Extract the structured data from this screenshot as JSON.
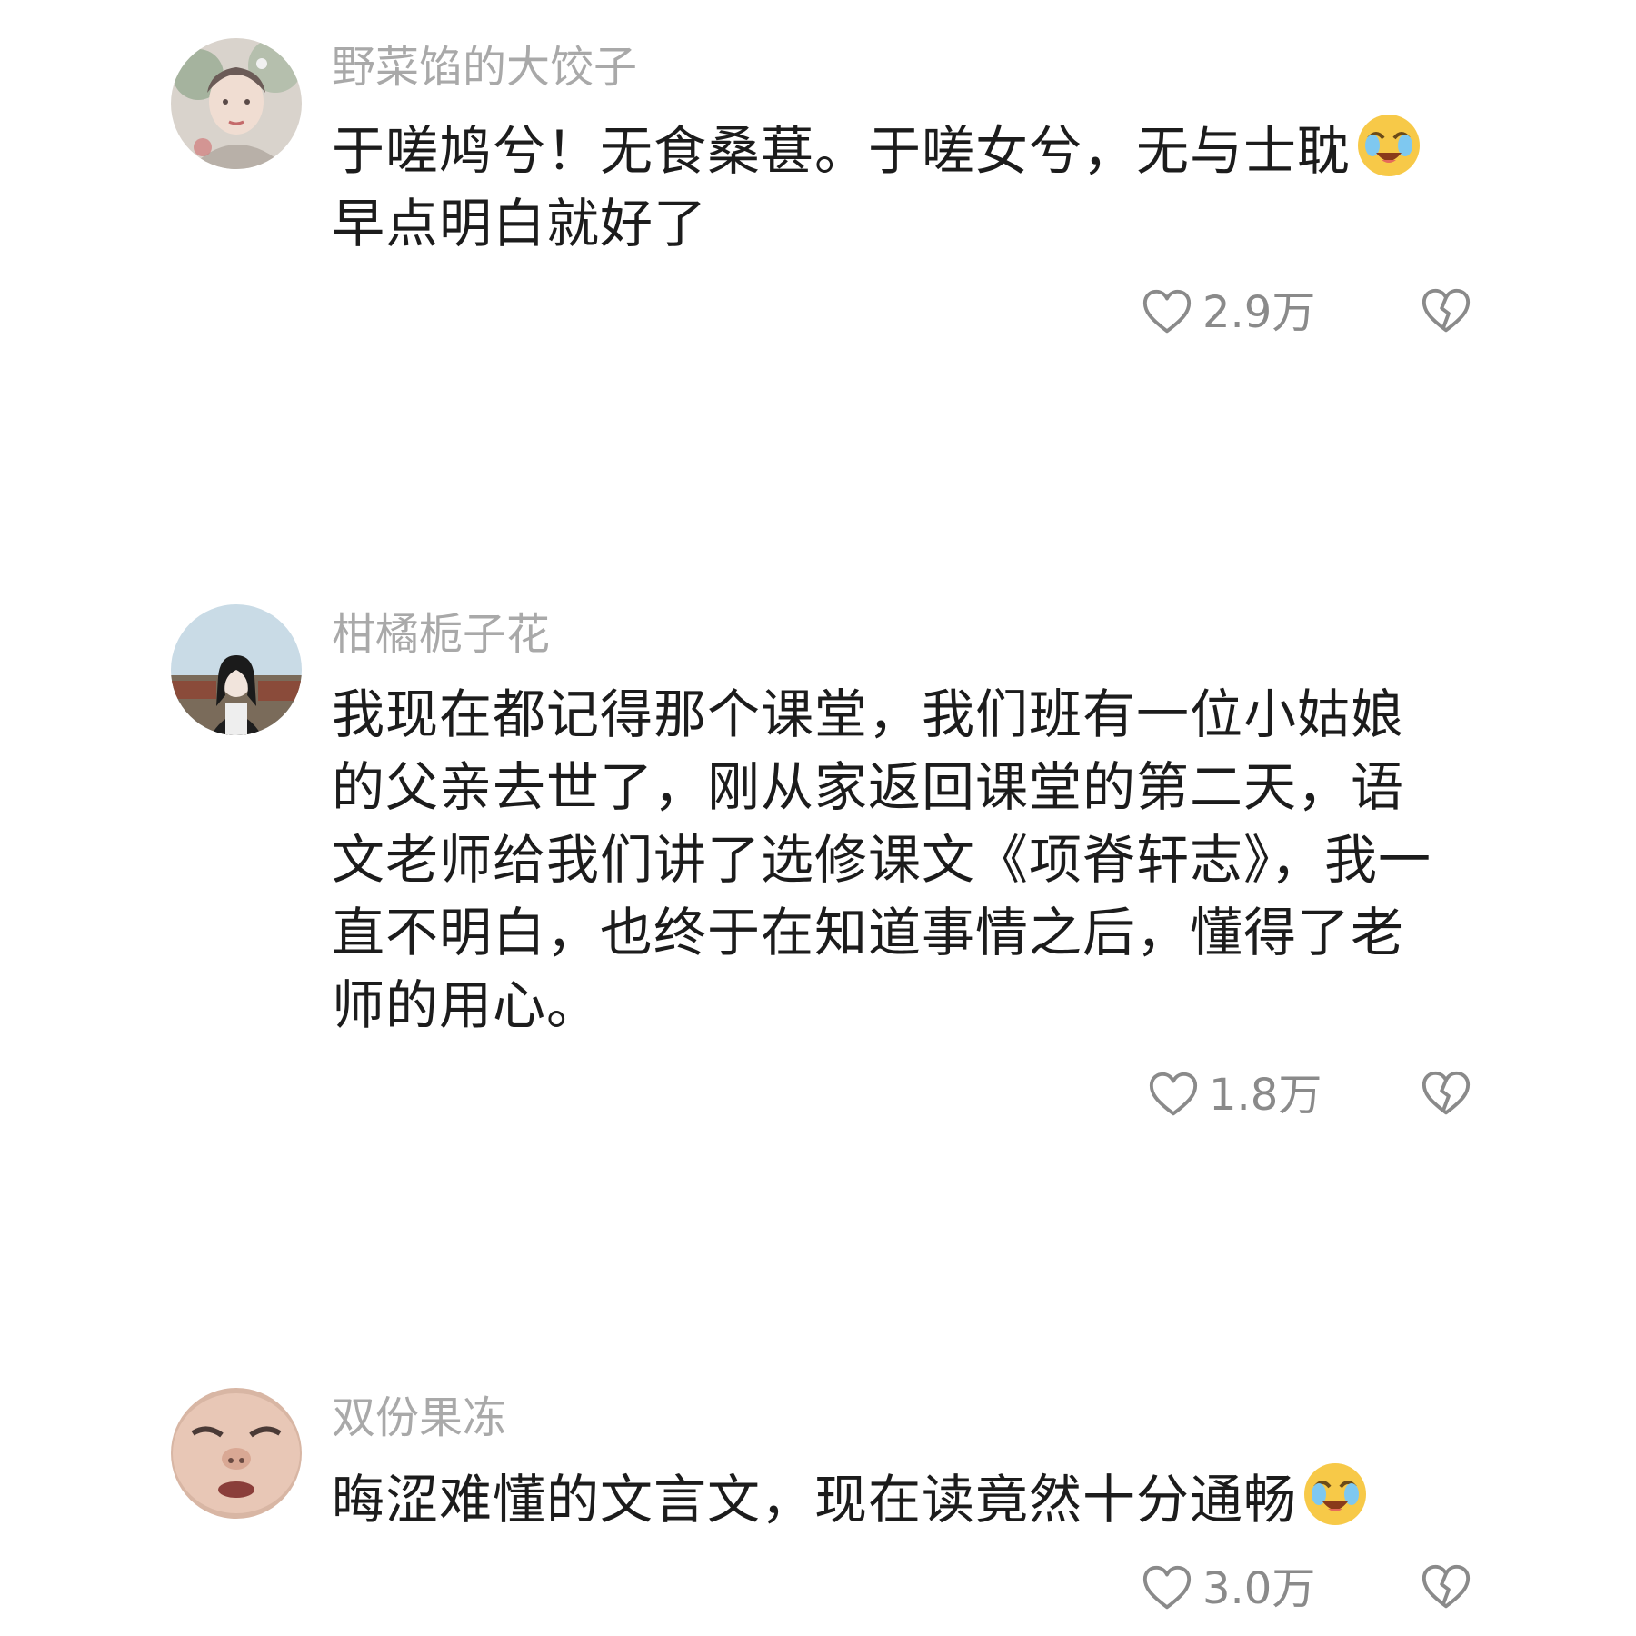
{
  "comments": [
    {
      "username": "野菜馅的大饺子",
      "text_lines": [
        "于嗟鸠兮！无食桑葚。于嗟女兮，无与士耽",
        "早点明白就好了"
      ],
      "emoji": "crying-laughing-emoji",
      "like_count": "2.9万",
      "avatar_icon": "illustrated-girl-avatar"
    },
    {
      "username": "柑橘栀子花",
      "text": "我现在都记得那个课堂，我们班有一位小姑娘的父亲去世了，刚从家返回课堂的第二天，语文老师给我们讲了选修课文《项脊轩志》，我一直不明白，也终于在知道事情之后，懂得了老师的用心。",
      "like_count": "1.8万",
      "avatar_icon": "photo-girl-avatar"
    },
    {
      "username": "双份果冻",
      "text": "晦涩难懂的文言文，现在读竟然十分通畅",
      "emoji": "crying-laughing-emoji",
      "like_count": "3.0万",
      "avatar_icon": "closeup-face-avatar"
    }
  ],
  "icons": {
    "like": "heart-outline-icon",
    "dislike": "broken-heart-icon"
  },
  "colors": {
    "username": "#a9a9a9",
    "text": "#1c1c1c",
    "meta": "#8a8a8a",
    "emoji": "#f7c948"
  }
}
